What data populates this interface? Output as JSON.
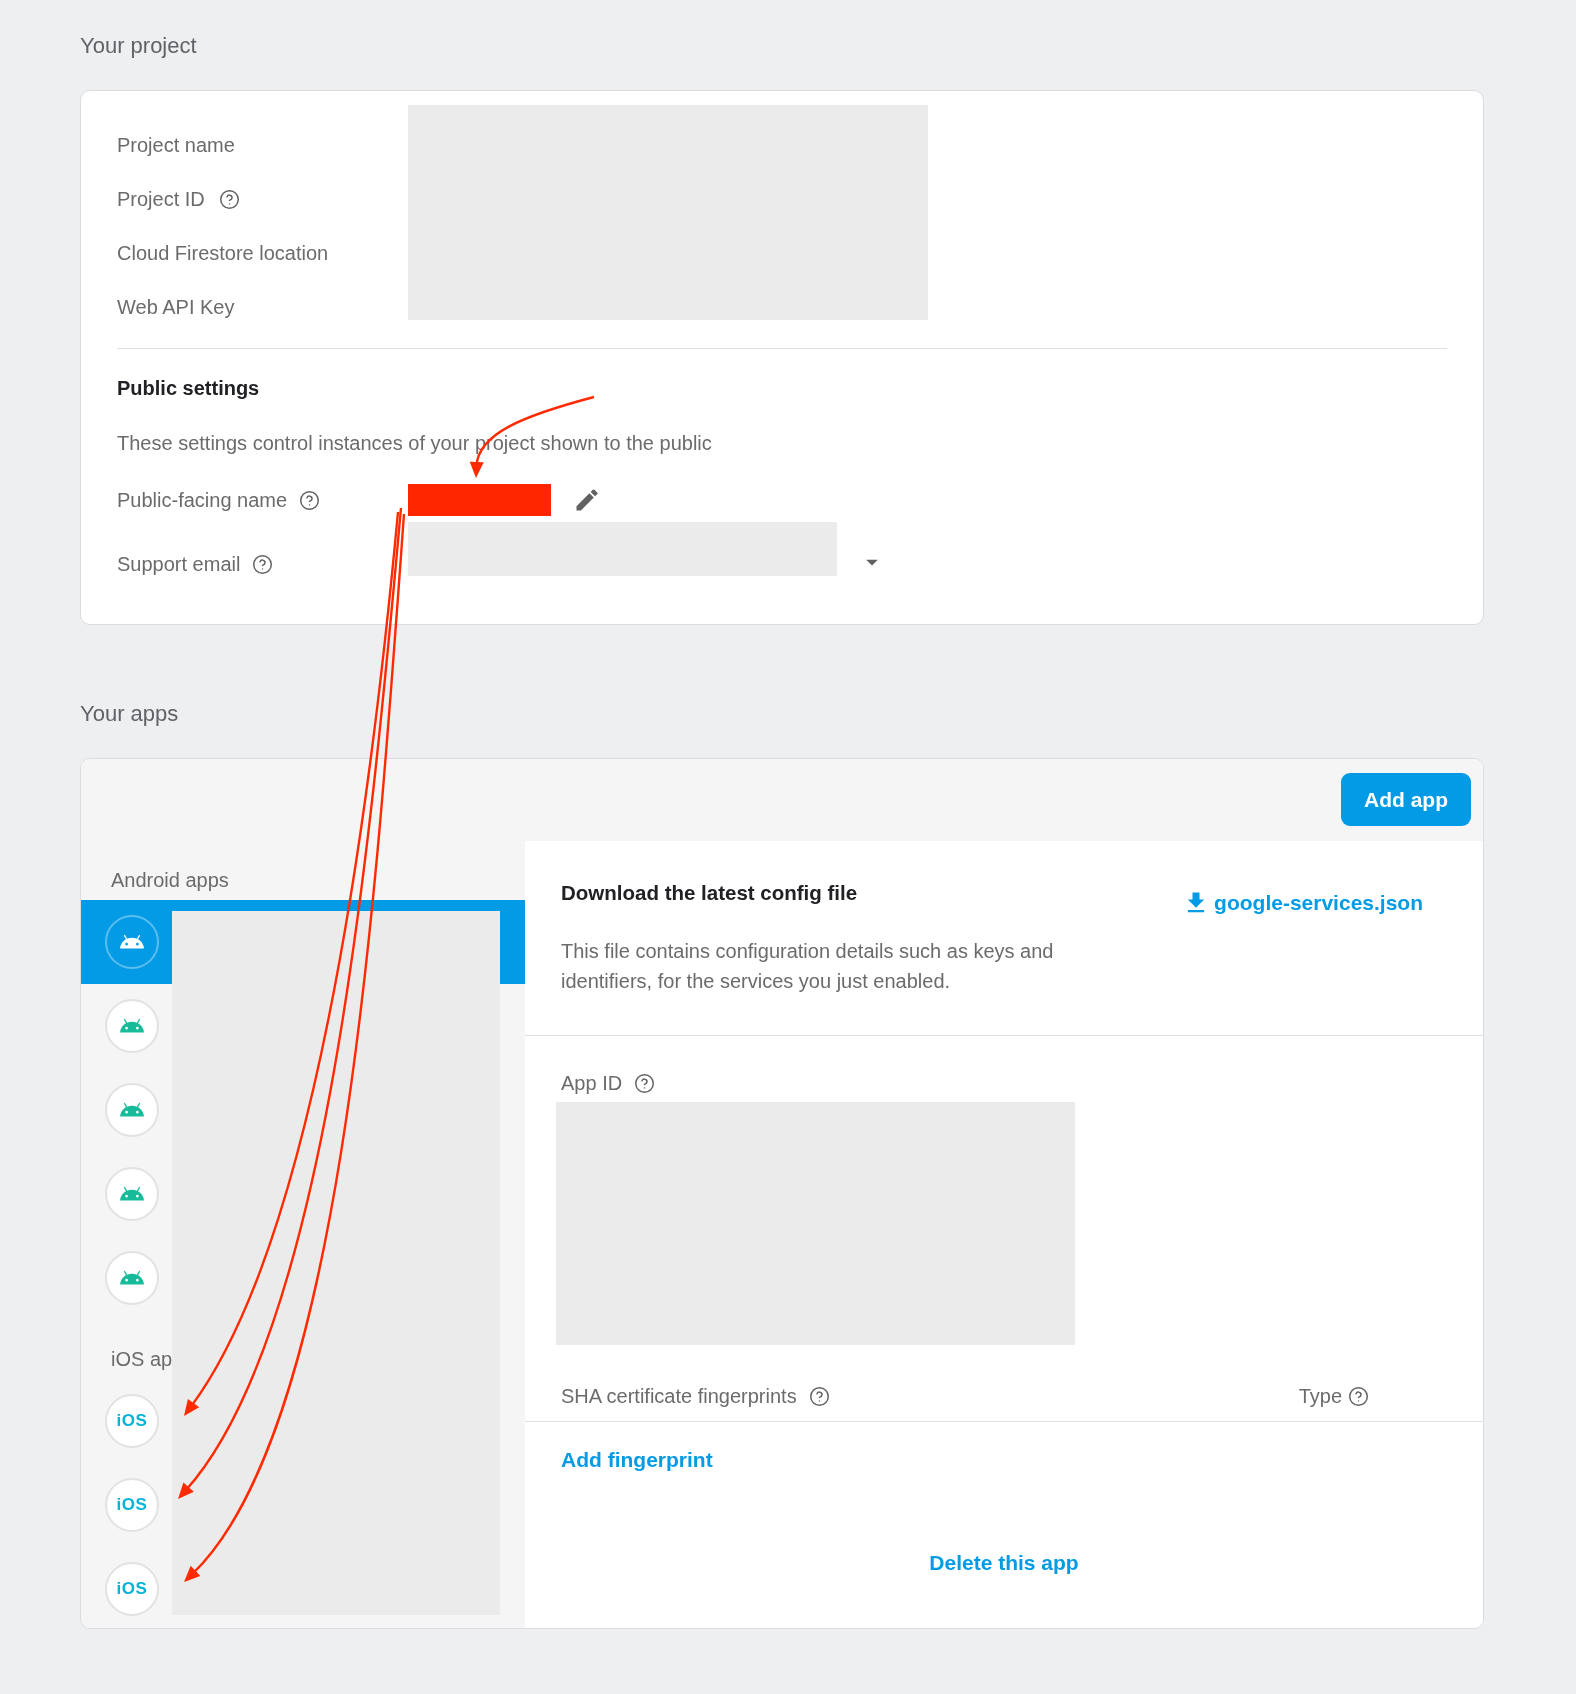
{
  "project": {
    "heading": "Your project",
    "fields": [
      {
        "label": "Project name",
        "help": false
      },
      {
        "label": "Project ID",
        "help": true
      },
      {
        "label": "Cloud Firestore location",
        "help": false
      },
      {
        "label": "Web API Key",
        "help": false
      }
    ],
    "public_settings": {
      "title": "Public settings",
      "description": "These settings control instances of your project shown to the public",
      "fields": [
        {
          "kind": "editable",
          "label": "Public-facing name",
          "help": true
        },
        {
          "kind": "dropdown",
          "label": "Support email",
          "help": true
        }
      ]
    }
  },
  "apps": {
    "heading": "Your apps",
    "add_button": "Add app",
    "groups": [
      {
        "label": "Android apps",
        "items": [
          {
            "kind": "android",
            "selected": true
          },
          {
            "kind": "android",
            "selected": false
          },
          {
            "kind": "android",
            "selected": false
          },
          {
            "kind": "android",
            "selected": false
          },
          {
            "kind": "android",
            "selected": false
          }
        ]
      },
      {
        "label": "iOS ap",
        "items": [
          {
            "kind": "ios",
            "badge": "iOS",
            "selected": false
          },
          {
            "kind": "ios",
            "badge": "iOS",
            "selected": false
          },
          {
            "kind": "ios",
            "badge": "iOS",
            "selected": false
          }
        ]
      }
    ],
    "config": {
      "title": "Download the latest config file",
      "download_link": "google-services.json",
      "description": "This file contains configuration details such as keys and identifiers, for the services you just enabled."
    },
    "app_id": {
      "label": "App ID",
      "help": true
    },
    "fingerprints": {
      "label": "SHA certificate fingerprints",
      "help": true,
      "type_label": "Type",
      "type_help": true,
      "add_link": "Add fingerprint"
    },
    "delete_link": "Delete this app"
  }
}
